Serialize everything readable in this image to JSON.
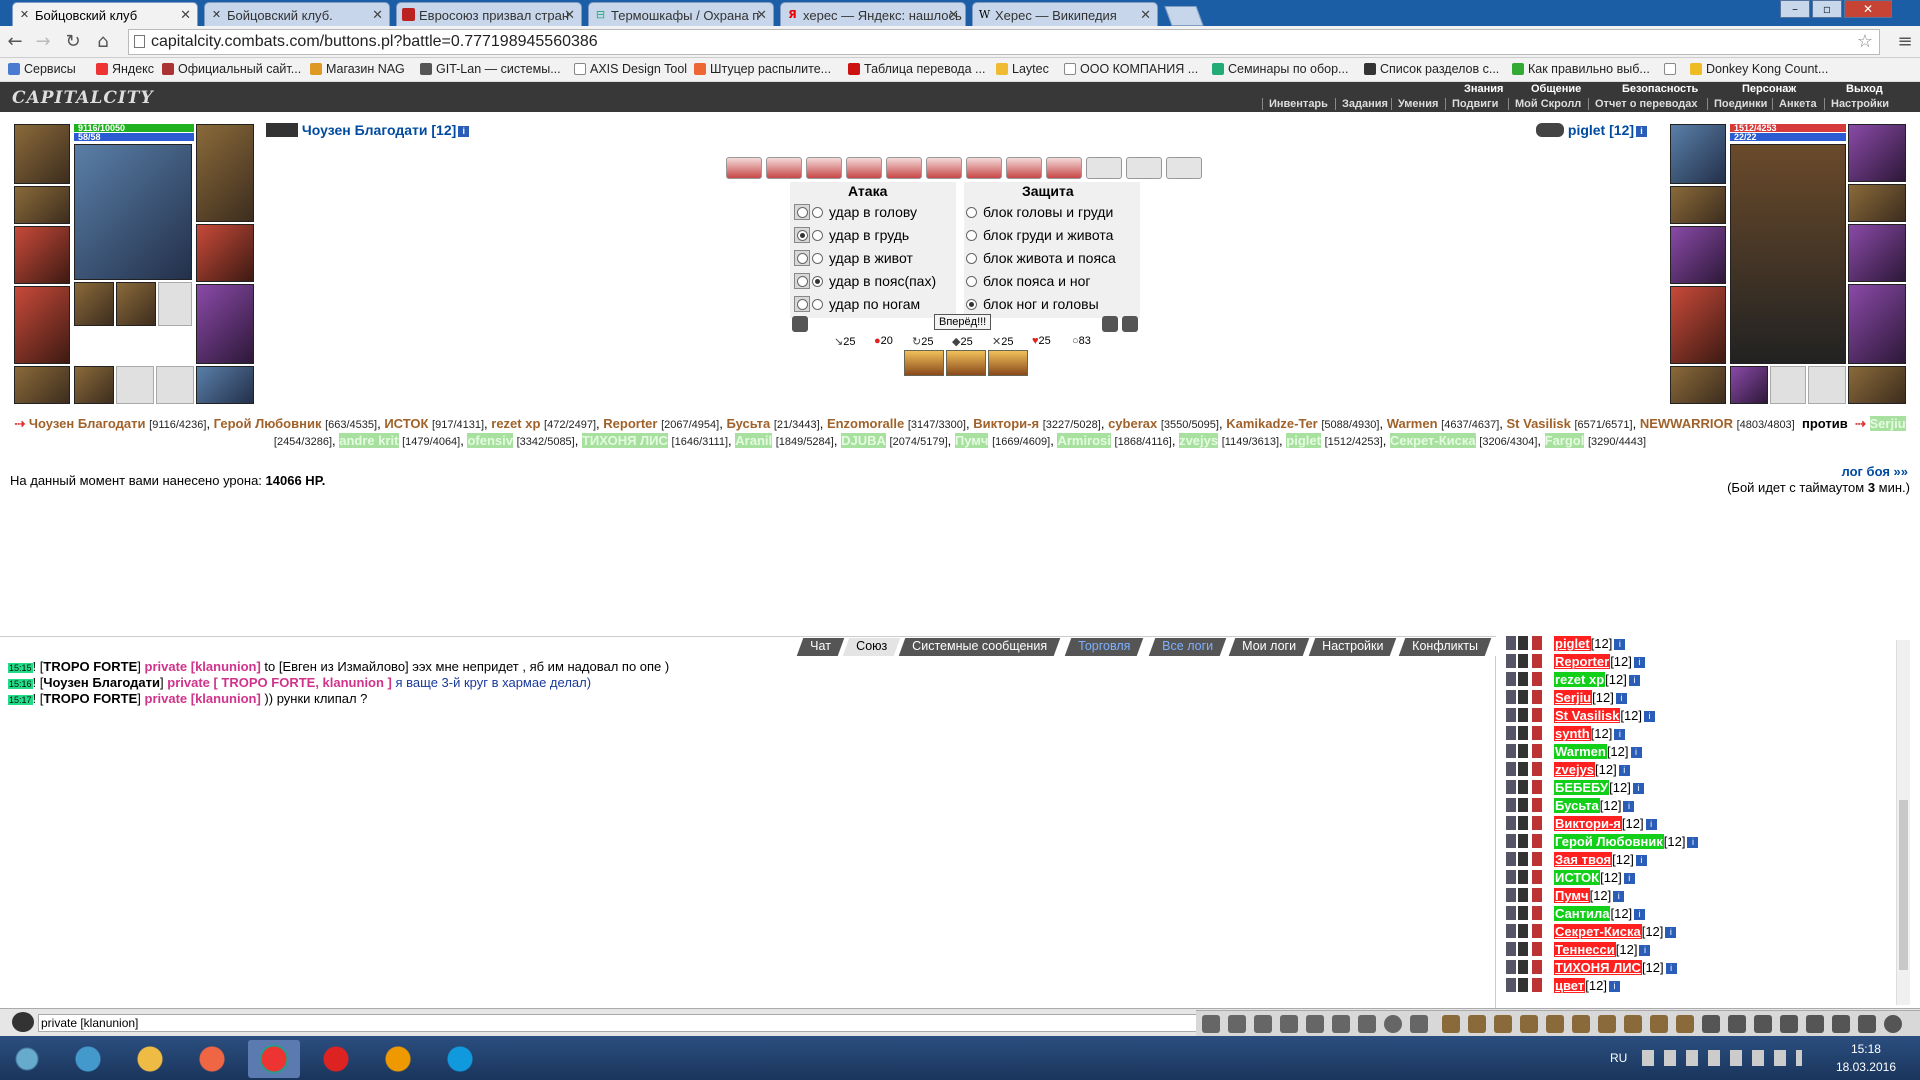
{
  "browser": {
    "tabs": [
      {
        "label": "Бойцовский клуб",
        "icon": "sword-icon",
        "active": true
      },
      {
        "label": "Бойцовский клуб.",
        "icon": "sword-icon",
        "active": false
      },
      {
        "label": "Евросоюз призвал стран",
        "icon": "news-icon",
        "active": false
      },
      {
        "label": "Термошкафы / Охрана п",
        "icon": "shield-icon",
        "active": false
      },
      {
        "label": "херес — Яндекс: нашлось",
        "icon": "yandex-icon",
        "active": false
      },
      {
        "label": "Херес — Википедия",
        "icon": "wikipedia-icon",
        "active": false
      }
    ],
    "url": "capitalcity.combats.com/buttons.pl?battle=0.777198945560386",
    "bookmarks": [
      "Сервисы",
      "Яндекс",
      "Официальный сайт...",
      "Магазин NAG",
      "GIT-Lan — системы...",
      "AXIS Design Tool",
      "Штуцер распылите...",
      "Таблица перевода ...",
      "Laytec",
      "ООО КОМПАНИЯ ...",
      "Семинары по обор...",
      "Список разделов с...",
      "Как правильно выб...",
      "Donkey Kong Count..."
    ]
  },
  "game": {
    "logo": "CAPITALCITY",
    "menu_top": [
      "Знания",
      "Общение",
      "Безопасность",
      "Персонаж",
      "Выход"
    ],
    "menu_bottom": [
      "Инвентарь",
      "Задания",
      "Умения",
      "Подвиги",
      "Мой Скролл",
      "Отчет о переводах",
      "Поединки",
      "Анкета",
      "Настройки"
    ],
    "left_char": {
      "name": "Чоузен Благодати",
      "level": "[12]",
      "hp": "9116/10050",
      "mp": "58/58"
    },
    "right_char": {
      "name": "piglet",
      "level": "[12]",
      "hp": "1512/4253",
      "mp": "22/22"
    },
    "attack_header": "Атака",
    "defense_header": "Защита",
    "attack_options": [
      "удар в голову",
      "удар в грудь",
      "удар в живот",
      "удар в пояс(пах)",
      "удар по ногам"
    ],
    "defense_options": [
      "блок головы и груди",
      "блок груди и живота",
      "блок живота и пояса",
      "блок пояса и ног",
      "блок ног и головы"
    ],
    "selected_attack": "удар в грудь",
    "selected_attack2": "удар в пояс(пах)",
    "selected_defense": "блок ног и головы",
    "go_button": "Вперёд!!!",
    "stats": [
      "25",
      "20",
      "25",
      "25",
      "25",
      "25",
      "83"
    ],
    "damage_label": "На данный момент вами нанесено урона:",
    "damage_value": "14066 HP.",
    "log_link": "лог боя »»",
    "timeout_text": "(Бой идет с таймаутом",
    "timeout_value": "3",
    "timeout_unit": "мин.)",
    "versus": "против"
  },
  "team1": [
    {
      "name": "Чоузен Благодати",
      "hp": "[9116/4236]"
    },
    {
      "name": "Герой Любовник",
      "hp": "[663/4535]"
    },
    {
      "name": "ИСТОК",
      "hp": "[917/4131]"
    },
    {
      "name": "rezet xp",
      "hp": "[472/2497]"
    },
    {
      "name": "Reporter",
      "hp": "[2067/4954]"
    },
    {
      "name": "Бусьта",
      "hp": "[21/3443]"
    },
    {
      "name": "Enzomoralle",
      "hp": "[3147/3300]"
    },
    {
      "name": "Виктори-я",
      "hp": "[3227/5028]"
    },
    {
      "name": "cyberax",
      "hp": "[3550/5095]"
    },
    {
      "name": "Kamikadze-Ter",
      "hp": "[5088/4930]"
    },
    {
      "name": "Warmen",
      "hp": "[4637/4637]"
    },
    {
      "name": "St Vasilisk",
      "hp": "[6571/6571]"
    },
    {
      "name": "NEWWARRIOR",
      "hp": "[4803/4803]"
    }
  ],
  "team2": [
    {
      "name": "Serjiu",
      "hp": "[2454/3286]"
    },
    {
      "name": "andre krit",
      "hp": "[1479/4064]"
    },
    {
      "name": "ofensiv",
      "hp": "[3342/5085]"
    },
    {
      "name": "ТИХОНЯ ЛИС",
      "hp": "[1646/3111]"
    },
    {
      "name": "Aranil",
      "hp": "[1849/5284]"
    },
    {
      "name": "DJUBA",
      "hp": "[2074/5179]"
    },
    {
      "name": "Пумч",
      "hp": "[1669/4609]"
    },
    {
      "name": "Armirosi",
      "hp": "[1868/4116]"
    },
    {
      "name": "zvejys",
      "hp": "[1149/3613]"
    },
    {
      "name": "piglet",
      "hp": "[1512/4253]"
    },
    {
      "name": "Секрет-Киска",
      "hp": "[3206/4304]"
    },
    {
      "name": "Fargol",
      "hp": "[3290/4443]"
    }
  ],
  "chat": {
    "tabs": [
      "Чат",
      "Союз",
      "Системные сообщения",
      "Торговля",
      "Все логи",
      "Мои логи",
      "Настройки",
      "Конфликты"
    ],
    "lines": [
      {
        "time": "15:15",
        "sender": "TROPO FORTE",
        "private": "private [klanunion]",
        "mid": " to [Евген из Измайлово] ",
        "text": "ээх мне непридет , яб им надовал по опе )"
      },
      {
        "time": "15:16",
        "sender": "Чоузен Благодати",
        "private": "private [ TROPO FORTE, klanunion ]",
        "mid": " ",
        "text": "я ваще 3-й круг в хармае делал)"
      },
      {
        "time": "15:17",
        "sender": "TROPO FORTE",
        "private": "private [klanunion]",
        "mid": " ",
        "text": ")) рунки клипал ?"
      }
    ],
    "input_value": "private [klanunion]"
  },
  "players": [
    {
      "name": "piglet",
      "lvl": "[12]",
      "c": "r"
    },
    {
      "name": "Reporter",
      "lvl": "[12]",
      "c": "r"
    },
    {
      "name": "rezet xp",
      "lvl": "[12]",
      "c": "g"
    },
    {
      "name": "Serjiu",
      "lvl": "[12]",
      "c": "r"
    },
    {
      "name": "St Vasilisk",
      "lvl": "[12]",
      "c": "r"
    },
    {
      "name": "synth",
      "lvl": "[12]",
      "c": "r"
    },
    {
      "name": "Warmen",
      "lvl": "[12]",
      "c": "g"
    },
    {
      "name": "zvejys",
      "lvl": "[12]",
      "c": "r"
    },
    {
      "name": "БЕБЕБУ",
      "lvl": "[12]",
      "c": "g"
    },
    {
      "name": "Бусьта",
      "lvl": "[12]",
      "c": "g"
    },
    {
      "name": "Виктори-я",
      "lvl": "[12]",
      "c": "r"
    },
    {
      "name": "Герой Любовник",
      "lvl": "[12]",
      "c": "g"
    },
    {
      "name": "Зая твоя",
      "lvl": "[12]",
      "c": "r"
    },
    {
      "name": "ИСТОК",
      "lvl": "[12]",
      "c": "g"
    },
    {
      "name": "Пумч",
      "lvl": "[12]",
      "c": "r"
    },
    {
      "name": "Сантила",
      "lvl": "[12]",
      "c": "g"
    },
    {
      "name": "Секрет-Киска",
      "lvl": "[12]",
      "c": "r"
    },
    {
      "name": "Теннесси",
      "lvl": "[12]",
      "c": "r"
    },
    {
      "name": "ТИХОНЯ ЛИС",
      "lvl": "[12]",
      "c": "r"
    },
    {
      "name": "цвет",
      "lvl": "[12]",
      "c": "r"
    }
  ],
  "taskbar": {
    "lang": "RU",
    "time": "15:18",
    "date": "18.03.2016"
  }
}
